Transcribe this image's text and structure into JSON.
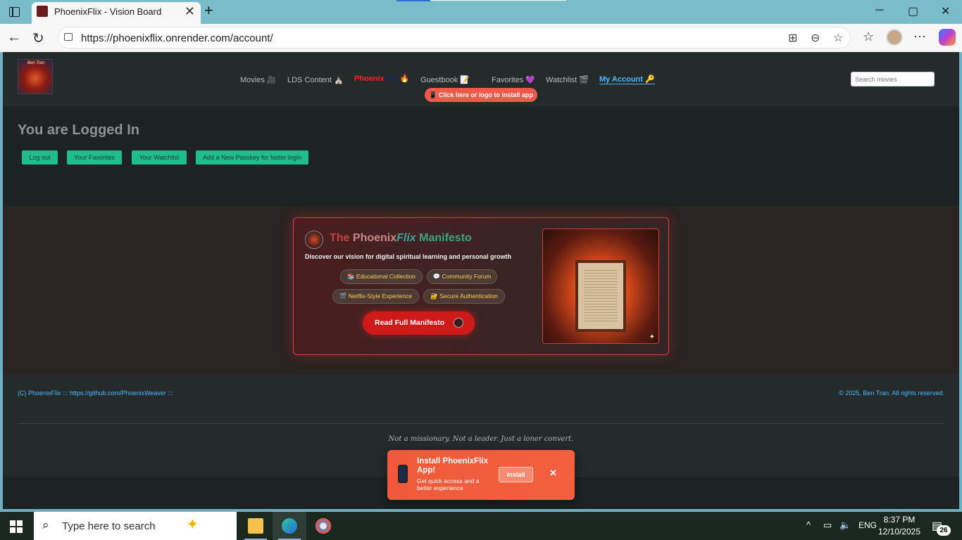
{
  "browser": {
    "tab_title": "PhoenixFlix - Vision Board",
    "tab_close": "✕",
    "new_tab": "+",
    "url": "https://phoenixflix.onrender.com/account/",
    "window_controls": [
      "─",
      "▢",
      "✕"
    ]
  },
  "site": {
    "logo_text": "Ben Tran",
    "nav": [
      {
        "label": "Movies 🎥"
      },
      {
        "label": "LDS Content ⛪"
      },
      {
        "label_red": "Phoenix",
        "label_dim": "Flix",
        "emoji": " 🔥"
      },
      {
        "label": "Guestbook 📝"
      },
      {
        "label": "Favorites 💜"
      },
      {
        "label": "Watchlist 🎬"
      },
      {
        "label": "My Account 🔑"
      }
    ],
    "install_pill": "📱 Click here or logo to install app",
    "search_placeholder": "Search movies"
  },
  "account": {
    "title": "You are Logged In",
    "buttons": [
      "Log out",
      "Your Favorites",
      "Your Watchlist",
      "Add a New Passkey for faster login"
    ]
  },
  "manifesto": {
    "title_parts": [
      "The ",
      "Phoenix",
      "Flix",
      " Manifesto"
    ],
    "subtitle": "Discover our vision for digital spiritual learning and personal growth",
    "chips": [
      "📚 Educational Collection",
      "💬 Community Forum",
      "🎬 Netflix-Style Experience",
      "🔐 Secure Authentication"
    ],
    "read_button": "Read Full Manifesto",
    "image_spark": "✦"
  },
  "footer": {
    "left": "(C) PhoenixFlix ::: https://github.com/PhoenixWeaver :::",
    "right": "© 2025, Ben Tran. All rights reserved.",
    "tagline": "Not a missionary. Not a leader. Just a loner convert."
  },
  "install_popup": {
    "title": "Install PhoenixFlix App!",
    "subtitle": "Get quick access and a better experience",
    "button": "Install",
    "close": "✕"
  },
  "taskbar": {
    "search_placeholder": "Type here to search",
    "language": "ENG",
    "time": "8:37 PM",
    "date": "12/10/2025",
    "notification_count": "26"
  },
  "colors": {
    "accent_green": "#1fbd8a",
    "link_blue": "#4cb8ff",
    "manifesto_red": "#cf1a1a"
  }
}
